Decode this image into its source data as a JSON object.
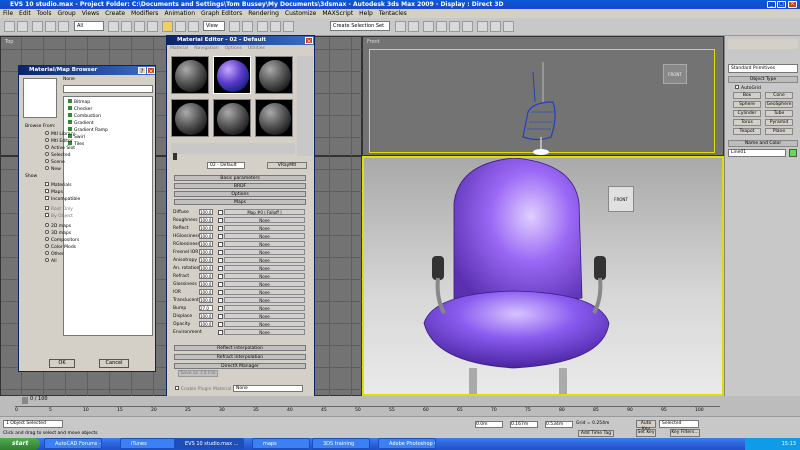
{
  "app": {
    "title": "EVS 10 studio.max    - Project Folder: C:\\Documents and Settings\\Tom Bussey\\My Documents\\3dsmax    - Autodesk 3ds Max  2009    - Display : Direct 3D"
  },
  "menu": [
    "File",
    "Edit",
    "Tools",
    "Group",
    "Views",
    "Create",
    "Modifiers",
    "Animation",
    "Graph Editors",
    "Rendering",
    "Customize",
    "MAXScript",
    "Help",
    "Tentacles"
  ],
  "toolbar": {
    "filter": "All",
    "view": "View",
    "selection_set": "Create Selection Set"
  },
  "viewports": {
    "top": "Top",
    "left": "Front",
    "persp": "Perspective",
    "front_label": "FRONT"
  },
  "browser": {
    "title": "Material/Map Browser",
    "none": "None",
    "browse_from": "Browse From:",
    "browse_options": [
      "Mtl Library",
      "Mtl Editor",
      "Active Slot",
      "Selected",
      "Scene",
      "New"
    ],
    "show": "Show",
    "show_options": [
      "Materials",
      "Maps",
      "Incompatible"
    ],
    "root": [
      "Root Only",
      "By Object"
    ],
    "types": [
      "2D maps",
      "3D maps",
      "Compositors",
      "Color Mods",
      "Other",
      "All"
    ],
    "maps": [
      "Bitmap",
      "Checker",
      "Combustion",
      "Gradient",
      "Gradient Ramp",
      "Swirl",
      "Tiles"
    ],
    "ok": "OK",
    "cancel": "Cancel"
  },
  "mat": {
    "title": "Material Editor - 02 - Default",
    "menu": [
      "Material",
      "Navigation",
      "Options",
      "Utilities"
    ],
    "name": "02 - Default",
    "type": "VRayMtl",
    "rollouts": [
      "Basic parameters",
      "BRDF",
      "Options",
      "Maps"
    ],
    "maps": [
      {
        "name": "Diffuse",
        "val": "100.0",
        "map": "Map #0 ( Falloff )"
      },
      {
        "name": "Roughness",
        "val": "100.0",
        "map": "None"
      },
      {
        "name": "Reflect",
        "val": "100.0",
        "map": "None"
      },
      {
        "name": "HGlossiness",
        "val": "100.0",
        "map": "None"
      },
      {
        "name": "RGlossiness",
        "val": "100.0",
        "map": "None"
      },
      {
        "name": "Fresnel IOR",
        "val": "100.0",
        "map": "None"
      },
      {
        "name": "Anisotropy",
        "val": "100.0",
        "map": "None"
      },
      {
        "name": "An. rotation",
        "val": "100.0",
        "map": "None"
      },
      {
        "name": "Refract",
        "val": "100.0",
        "map": "None"
      },
      {
        "name": "Glossiness",
        "val": "100.0",
        "map": "None"
      },
      {
        "name": "IOR",
        "val": "100.0",
        "map": "None"
      },
      {
        "name": "Translucent",
        "val": "100.0",
        "map": "None"
      },
      {
        "name": "Bump",
        "val": "27.0",
        "map": "None"
      },
      {
        "name": "Displace",
        "val": "100.0",
        "map": "None"
      },
      {
        "name": "Opacity",
        "val": "100.0",
        "map": "None"
      },
      {
        "name": "Environment",
        "val": "",
        "map": "None"
      }
    ],
    "bottom_rollouts": [
      "Reflect interpolation",
      "Refract interpolation",
      "DirectX Manager"
    ],
    "save_fx": "Save as .FX File",
    "plugin": "Enable Plugin Material",
    "plugin_val": "None",
    "mental": "mental ray Connection"
  },
  "cmd": {
    "dropdown": "Standard Primitives",
    "object_type": "Object Type",
    "autogrid": "AutoGrid",
    "buttons": [
      "Box",
      "Cone",
      "Sphere",
      "GeoSphere",
      "Cylinder",
      "Tube",
      "Torus",
      "Pyramid",
      "Teapot",
      "Plane"
    ],
    "name_color": "Name and Color",
    "name": "Line01"
  },
  "timeline": {
    "frame": "0 / 100",
    "ticks": [
      "0",
      "5",
      "10",
      "15",
      "20",
      "25",
      "30",
      "35",
      "40",
      "45",
      "50",
      "55",
      "60",
      "65",
      "70",
      "75",
      "80",
      "85",
      "90",
      "95",
      "100"
    ]
  },
  "status": {
    "selected": "1 Object Selected",
    "prompt": "Click and drag to select and move objects",
    "x": "0.0m",
    "y": "0.167m",
    "z": "0.534m",
    "grid": "Grid = 0.254m",
    "autokey": "Auto Key",
    "setkey": "Set Key",
    "sel": "Selected",
    "keyfilters": "Key Filters...",
    "addtime": "Add Time Tag"
  },
  "taskbar": {
    "start": "start",
    "items": [
      "AutoCAD Forums - Po...",
      "iTunes",
      "EVS 10 studio.max ...",
      "maps",
      "3DS training",
      "Adobe Photoshop CS..."
    ],
    "clock": "15:13"
  },
  "colors": {
    "chair": "#8a5cf0",
    "title": "#0a5ad8",
    "taskbar": "#245edb",
    "start": "#3c9a3c"
  }
}
